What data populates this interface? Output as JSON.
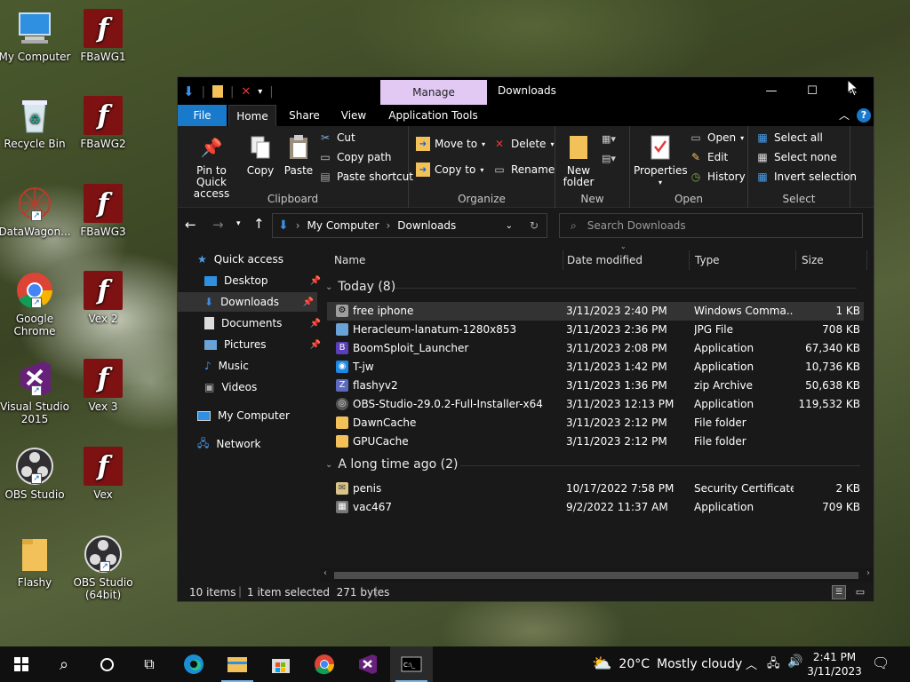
{
  "desktop": {
    "icons": [
      {
        "label": "My Computer",
        "icon": "monitor-icon"
      },
      {
        "label": "FBaWG1",
        "icon": "flash-icon"
      },
      {
        "label": "Recycle Bin",
        "icon": "recycle-bin-icon"
      },
      {
        "label": "FBaWG2",
        "icon": "flash-icon"
      },
      {
        "label": "DataWagon...",
        "icon": "datawagon-icon"
      },
      {
        "label": "FBaWG3",
        "icon": "flash-icon"
      },
      {
        "label": "Google Chrome",
        "icon": "chrome-icon"
      },
      {
        "label": "Vex 2",
        "icon": "flash-icon"
      },
      {
        "label": "Visual Studio 2015",
        "icon": "visual-studio-icon"
      },
      {
        "label": "Vex 3",
        "icon": "flash-icon"
      },
      {
        "label": "OBS Studio",
        "icon": "obs-icon"
      },
      {
        "label": "Vex",
        "icon": "flash-icon"
      },
      {
        "label": "Flashy",
        "icon": "folder-icon"
      },
      {
        "label": "OBS Studio (64bit)",
        "icon": "obs-icon"
      }
    ]
  },
  "window": {
    "title": "Downloads",
    "manage_tab": "Manage",
    "controls": {
      "minimize": "—",
      "maximize": "☐",
      "close": "✕"
    },
    "tabs": {
      "file": "File",
      "home": "Home",
      "share": "Share",
      "view": "View",
      "app_tools": "Application Tools"
    },
    "ribbon": {
      "clipboard": {
        "label": "Clipboard",
        "pin": "Pin to Quick access",
        "copy": "Copy",
        "paste": "Paste",
        "cut": "Cut",
        "copy_path": "Copy path",
        "paste_shortcut": "Paste shortcut"
      },
      "organize": {
        "label": "Organize",
        "move_to": "Move to",
        "copy_to": "Copy to",
        "delete": "Delete",
        "rename": "Rename"
      },
      "new": {
        "label": "New",
        "new_folder": "New folder"
      },
      "open": {
        "label": "Open",
        "properties": "Properties",
        "open": "Open",
        "edit": "Edit",
        "history": "History"
      },
      "select": {
        "label": "Select",
        "select_all": "Select all",
        "select_none": "Select none",
        "invert": "Invert selection"
      }
    },
    "address": {
      "root": "My Computer",
      "current": "Downloads"
    },
    "search": {
      "placeholder": "Search Downloads"
    },
    "nav": {
      "quick_access": "Quick access",
      "items": [
        "Desktop",
        "Downloads",
        "Documents",
        "Pictures",
        "Music",
        "Videos"
      ],
      "my_computer": "My Computer",
      "network": "Network"
    },
    "columns": {
      "name": "Name",
      "date": "Date modified",
      "type": "Type",
      "size": "Size"
    },
    "groups": [
      {
        "title": "Today (8)",
        "files": [
          {
            "name": "free iphone",
            "date": "3/11/2023 2:40 PM",
            "type": "Windows Comma...",
            "size": "1 KB",
            "selected": true,
            "icon": "cmd-file-icon",
            "color": "#9e9e9e"
          },
          {
            "name": "Heracleum-lanatum-1280x853",
            "date": "3/11/2023 2:36 PM",
            "type": "JPG File",
            "size": "708 KB",
            "icon": "jpg-file-icon",
            "color": "#6aa3d8"
          },
          {
            "name": "BoomSploit_Launcher",
            "date": "3/11/2023 2:08 PM",
            "type": "Application",
            "size": "67,340 KB",
            "icon": "app-icon",
            "color": "#5b3fb8"
          },
          {
            "name": "T-jw",
            "date": "3/11/2023 1:42 PM",
            "type": "Application",
            "size": "10,736 KB",
            "icon": "app-icon",
            "color": "#1e88e5"
          },
          {
            "name": "flashyv2",
            "date": "3/11/2023 1:36 PM",
            "type": "zip Archive",
            "size": "50,638 KB",
            "icon": "zip-icon",
            "color": "#5c6bc0"
          },
          {
            "name": "OBS-Studio-29.0.2-Full-Installer-x64",
            "date": "3/11/2023 12:13 PM",
            "type": "Application",
            "size": "119,532 KB",
            "icon": "installer-icon",
            "color": "#555"
          },
          {
            "name": "DawnCache",
            "date": "3/11/2023 2:12 PM",
            "type": "File folder",
            "size": "",
            "icon": "folder-icon",
            "color": "#f3c15a"
          },
          {
            "name": "GPUCache",
            "date": "3/11/2023 2:12 PM",
            "type": "File folder",
            "size": "",
            "icon": "folder-icon",
            "color": "#f3c15a"
          }
        ]
      },
      {
        "title": "A long time ago (2)",
        "files": [
          {
            "name": "penis",
            "date": "10/17/2022 7:58 PM",
            "type": "Security Certificate",
            "size": "2 KB",
            "icon": "certificate-icon",
            "color": "#d9c48a"
          },
          {
            "name": "vac467",
            "date": "9/2/2022 11:37 AM",
            "type": "Application",
            "size": "709 KB",
            "icon": "app-icon",
            "color": "#777"
          }
        ]
      }
    ],
    "status": {
      "count": "10 items",
      "selection": "1 item selected  271 bytes"
    }
  },
  "taskbar": {
    "weather_temp": "20°C",
    "weather_desc": "Mostly cloudy",
    "time": "2:41 PM",
    "date": "3/11/2023"
  }
}
